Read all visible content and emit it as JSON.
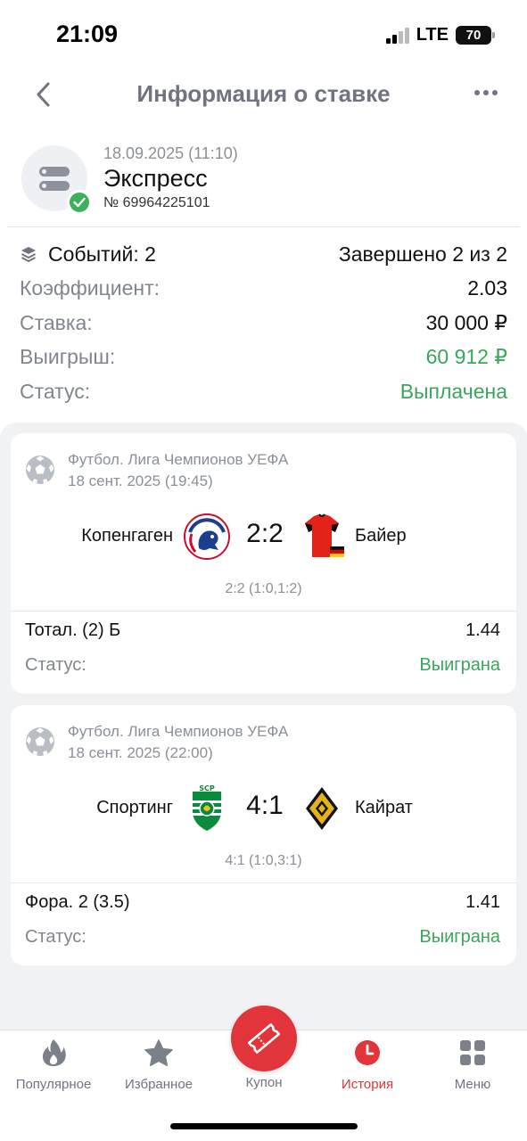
{
  "status_bar": {
    "time": "21:09",
    "network": "LTE",
    "battery": "70"
  },
  "header": {
    "title": "Информация о ставке",
    "back_icon": "chevron-left-icon",
    "more_icon": "more-dots-icon"
  },
  "bet": {
    "date": "18.09.2025 (11:10)",
    "type": "Экспресс",
    "number": "№ 69964225101"
  },
  "summary": {
    "events_label": "Событий: 2",
    "completed": "Завершено 2 из 2",
    "coef_label": "Коэффициент:",
    "coef_value": "2.03",
    "stake_label": "Ставка:",
    "stake_value": "30 000 ₽",
    "win_label": "Выигрыш:",
    "win_value": "60 912 ₽",
    "status_label": "Статус:",
    "status_value": "Выплачена"
  },
  "events": [
    {
      "league": "Футбол. Лига Чемпионов УЕФА",
      "date": "18 сент. 2025 (19:45)",
      "home": "Копенгаген",
      "score": "2:2",
      "away": "Байер",
      "sub_score": "2:2 (1:0,1:2)",
      "market": "Тотал. (2) Б",
      "odds": "1.44",
      "status_label": "Статус:",
      "status_value": "Выиграна"
    },
    {
      "league": "Футбол. Лига Чемпионов УЕФА",
      "date": "18 сент. 2025 (22:00)",
      "home": "Спортинг",
      "score": "4:1",
      "away": "Кайрат",
      "sub_score": "4:1 (1:0,3:1)",
      "market": "Фора. 2 (3.5)",
      "odds": "1.41",
      "status_label": "Статус:",
      "status_value": "Выиграна"
    }
  ],
  "tabbar": {
    "items": [
      {
        "label": "Популярное",
        "icon": "flame-icon"
      },
      {
        "label": "Избранное",
        "icon": "star-icon"
      },
      {
        "label": "Купон",
        "icon": "ticket-icon"
      },
      {
        "label": "История",
        "icon": "clock-icon"
      },
      {
        "label": "Меню",
        "icon": "grid-icon"
      }
    ]
  },
  "colors": {
    "accent": "#e1343b",
    "success": "#3aa65a",
    "muted": "#80858f"
  }
}
